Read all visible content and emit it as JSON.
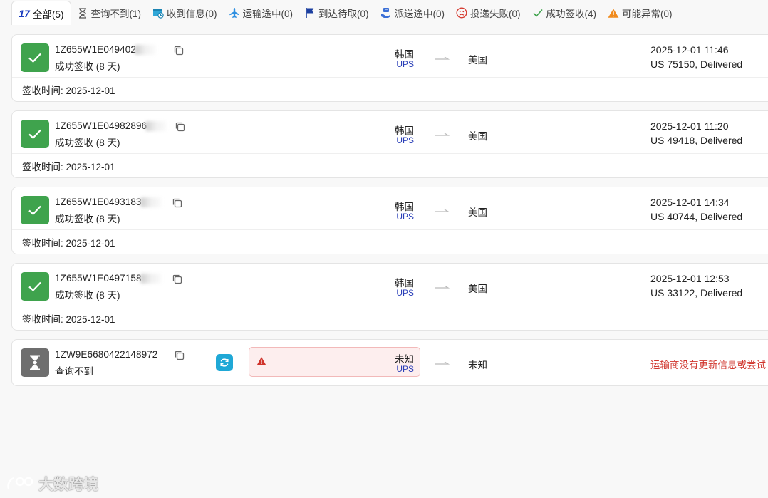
{
  "tabs": [
    {
      "label": "全部(5)",
      "icon": "17track-logo",
      "icon_text": "17",
      "active": true
    },
    {
      "label": "查询不到(1)",
      "icon": "hourglass-icon"
    },
    {
      "label": "收到信息(0)",
      "icon": "calendar-clock-icon"
    },
    {
      "label": "运输途中(0)",
      "icon": "airplane-icon"
    },
    {
      "label": "到达待取(0)",
      "icon": "flag-icon"
    },
    {
      "label": "派送途中(0)",
      "icon": "delivery-hand-icon"
    },
    {
      "label": "投递失败(0)",
      "icon": "sad-face-icon"
    },
    {
      "label": "成功签收(4)",
      "icon": "check-icon"
    },
    {
      "label": "可能异常(0)",
      "icon": "warning-triangle-icon"
    }
  ],
  "colors": {
    "success": "#3fa34d",
    "unknown": "#6e6e6e",
    "carrier_blue": "#2a3fb8",
    "error_red": "#d0342c",
    "refresh_blue": "#1fa8d6"
  },
  "shipments": [
    {
      "tracking": "1Z655W1E04940‌2",
      "status": "成功签收 (8 天)",
      "origin": "韩国",
      "carrier": "UPS",
      "destination": "美国",
      "event_time": "2025-12-01 11:46",
      "event_desc": "US 75150, Delivered",
      "signed": "签收时间: 2025-12-01"
    },
    {
      "tracking": "1Z655W1E04982896",
      "status": "成功签收 (8 天)",
      "origin": "韩国",
      "carrier": "UPS",
      "destination": "美国",
      "event_time": "2025-12-01 11:20",
      "event_desc": "US 49418, Delivered",
      "signed": "签收时间: 2025-12-01"
    },
    {
      "tracking": "1Z655W1E0493183",
      "status": "成功签收 (8 天)",
      "origin": "韩国",
      "carrier": "UPS",
      "destination": "美国",
      "event_time": "2025-12-01 14:34",
      "event_desc": "US 40744, Delivered",
      "signed": "签收时间: 2025-12-01"
    },
    {
      "tracking": "1Z655W1E0497158",
      "status": "成功签收 (8 天)",
      "origin": "韩国",
      "carrier": "UPS",
      "destination": "美国",
      "event_time": "2025-12-01 12:53",
      "event_desc": "US 33122, Delivered",
      "signed": "签收时间: 2025-12-01"
    }
  ],
  "unknown_shipment": {
    "tracking": "1ZW9E6680422148972",
    "status": "查询不到",
    "origin": "未知",
    "carrier": "UPS",
    "destination": "未知",
    "message": "运输商没有更新信息或尝试"
  },
  "watermark": "大数跨境"
}
